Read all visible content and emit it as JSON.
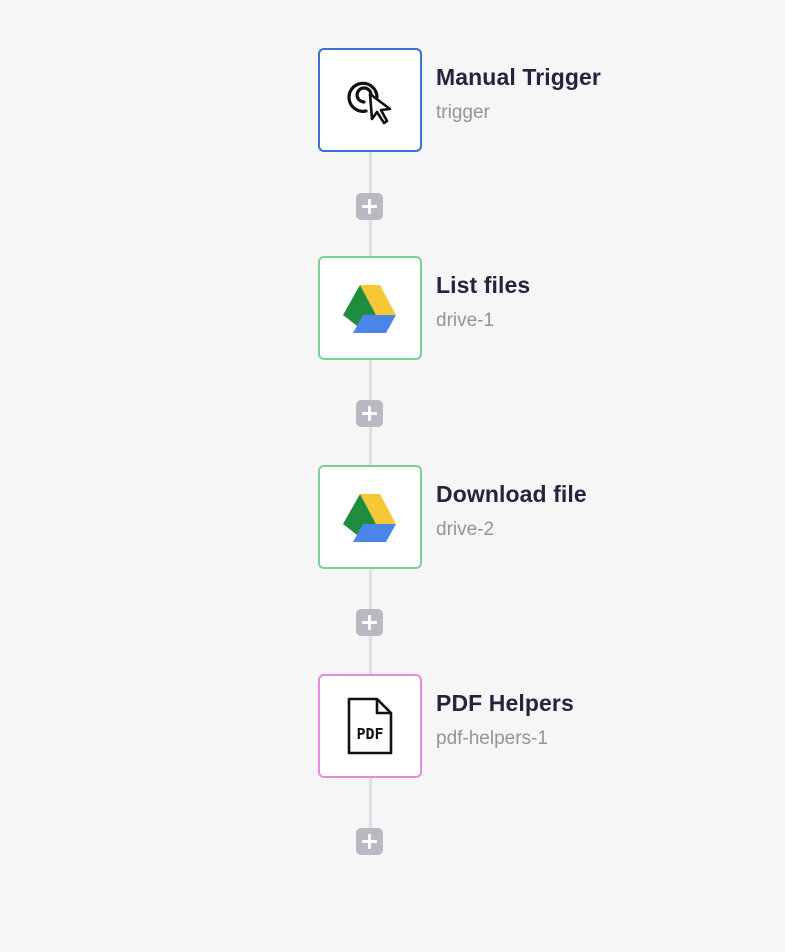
{
  "workflow": {
    "nodes": [
      {
        "title": "Manual Trigger",
        "subtitle": "trigger",
        "icon": "cursor-click-icon",
        "border_color": "#3f6ed6"
      },
      {
        "title": "List files",
        "subtitle": "drive-1",
        "icon": "google-drive-icon",
        "border_color": "#7ccf9a"
      },
      {
        "title": "Download file",
        "subtitle": "drive-2",
        "icon": "google-drive-icon",
        "border_color": "#7ccf9a"
      },
      {
        "title": "PDF Helpers",
        "subtitle": "pdf-helpers-1",
        "icon": "pdf-file-icon",
        "icon_label": "PDF",
        "border_color": "#e58be0"
      }
    ],
    "colors": {
      "background": "#f6f6f6",
      "connector": "#e0e0e2",
      "add_button": "#b9b9c4",
      "title_text": "#24253d",
      "subtitle_text": "#92939c",
      "drive_green": "#1e8e3e",
      "drive_yellow": "#f6c736",
      "drive_blue": "#4a86e8"
    }
  }
}
